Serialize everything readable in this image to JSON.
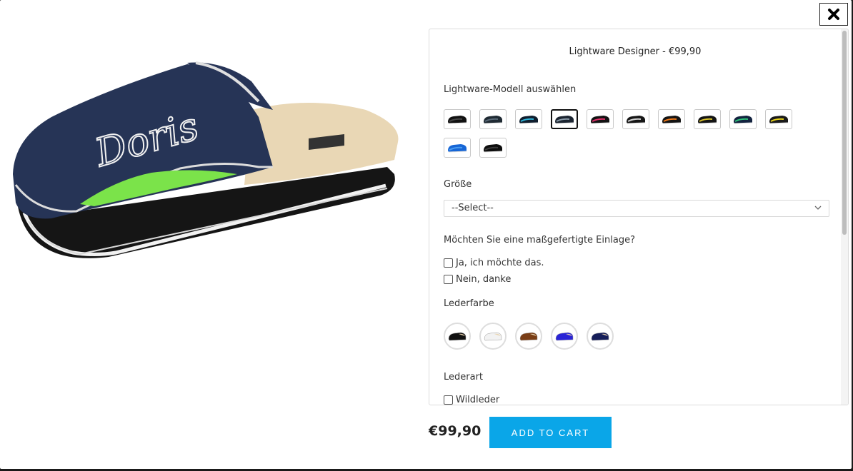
{
  "modal": {
    "close_icon": "close-x-icon",
    "product_image": {
      "embroidered_text": "Doris"
    }
  },
  "options": {
    "title": "Lightware Designer - €99,90",
    "model_label": "Lightware-Modell auswählen",
    "model_swatches": [
      {
        "name": "black",
        "color": "#111111",
        "accent": "#444444"
      },
      {
        "name": "dark-grey",
        "color": "#1f2a33",
        "accent": "#5a6a78"
      },
      {
        "name": "blue-stripe",
        "color": "#0f1e2e",
        "accent": "#2fb3d8"
      },
      {
        "name": "grey-stripe",
        "color": "#1b2430",
        "accent": "#8a9aa8",
        "selected": true
      },
      {
        "name": "pink-stripe",
        "color": "#121212",
        "accent": "#e0306a"
      },
      {
        "name": "white-stripe",
        "color": "#161616",
        "accent": "#d0d0d0"
      },
      {
        "name": "orange-stripe",
        "color": "#141414",
        "accent": "#f07a1a"
      },
      {
        "name": "yellow-dots",
        "color": "#141414",
        "accent": "#d8c22a"
      },
      {
        "name": "navy-green",
        "color": "#13233f",
        "accent": "#2ec47a"
      },
      {
        "name": "black-yellow",
        "color": "#1a1a1a",
        "accent": "#e8d31a"
      },
      {
        "name": "blue",
        "color": "#1766d6",
        "accent": "#4a9cf0"
      },
      {
        "name": "black-plain",
        "color": "#0d0d0d",
        "accent": "#3a3a3a"
      }
    ],
    "size_label": "Größe",
    "size_select_value": "--Select--",
    "insole_question": "Möchten Sie eine maßgefertigte Einlage?",
    "insole_options": [
      "Ja, ich möchte das.",
      "Nein, danke"
    ],
    "leather_color_label": "Lederfarbe",
    "leather_colors": [
      {
        "name": "black",
        "color": "#111111"
      },
      {
        "name": "white",
        "color": "#f2f2f2"
      },
      {
        "name": "brown",
        "color": "#7a3e16"
      },
      {
        "name": "royal-blue",
        "color": "#2a24d6"
      },
      {
        "name": "navy",
        "color": "#161e5a"
      }
    ],
    "leather_type_label": "Lederart",
    "leather_type_options": [
      "Wildleder"
    ]
  },
  "footer": {
    "price": "€99,90",
    "add_to_cart": "ADD TO CART",
    "accent_color": "#0aa6e8"
  }
}
